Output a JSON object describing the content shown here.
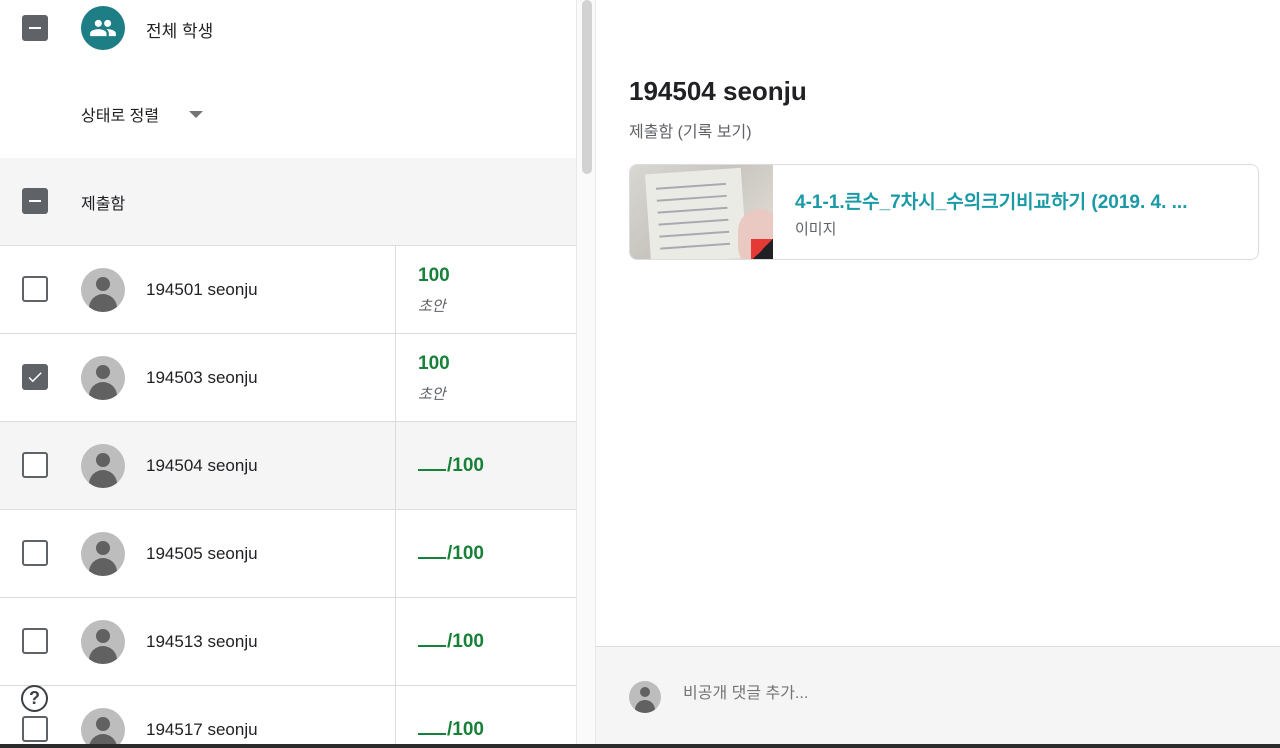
{
  "header": {
    "all_students_label": "전체 학생",
    "sort_label": "상태로 정렬"
  },
  "section": {
    "label": "제출함"
  },
  "students": [
    {
      "name": "194501 seonju",
      "grade": "100",
      "status": "초안",
      "checked": false
    },
    {
      "name": "194503 seonju",
      "grade": "100",
      "status": "초안",
      "checked": true
    },
    {
      "name": "194504 seonju",
      "grade": "/100",
      "status": "",
      "checked": false
    },
    {
      "name": "194505 seonju",
      "grade": "/100",
      "status": "",
      "checked": false
    },
    {
      "name": "194513 seonju",
      "grade": "/100",
      "status": "",
      "checked": false
    },
    {
      "name": "194517 seonju",
      "grade": "/100",
      "status": "",
      "checked": false
    }
  ],
  "help_label": "?",
  "detail": {
    "student_title": "194504 seonju",
    "status_text": "제출함 (기록 보기)",
    "attachment": {
      "title": "4-1-1.큰수_7차시_수의크기비교하기 (2019. 4. ...",
      "type": "이미지"
    },
    "comment_placeholder": "비공개 댓글 추가..."
  },
  "colors": {
    "accent": "#1e7e86",
    "grade": "#188038",
    "link": "#1a9aa6"
  }
}
